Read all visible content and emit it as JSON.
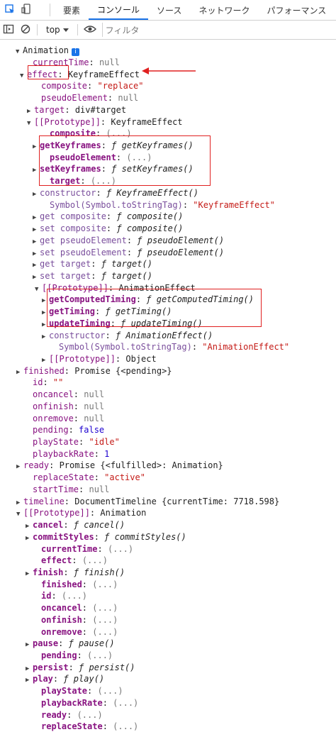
{
  "tabs": [
    "要素",
    "コンソール",
    "ソース",
    "ネットワーク",
    "パフォーマンス"
  ],
  "toolbar": {
    "context": "top",
    "filter_placeholder": "フィルタ"
  },
  "console": {
    "root_label": "Animation",
    "rows": [
      [
        "",
        "currentTime",
        ": ",
        "null"
      ],
      [
        "▼",
        "effect",
        ": ",
        "KeyframeEffect"
      ],
      [
        "",
        "composite",
        ": ",
        "\"replace\""
      ],
      [
        "",
        "pseudoElement",
        ": ",
        "null"
      ],
      [
        "▶",
        "target",
        ": ",
        "div#target"
      ],
      [
        "▼",
        "[[Prototype]]",
        ": ",
        "KeyframeEffect"
      ],
      [
        "",
        "composite",
        ": ",
        "(...)"
      ],
      [
        "▶",
        "getKeyframes",
        ": ",
        "ƒ getKeyframes()"
      ],
      [
        "",
        "pseudoElement",
        ": ",
        "(...)"
      ],
      [
        "▶",
        "setKeyframes",
        ": ",
        "ƒ setKeyframes()"
      ],
      [
        "",
        "target",
        ": ",
        "(...)"
      ],
      [
        "▶",
        "constructor",
        ": ",
        "ƒ KeyframeEffect()"
      ],
      [
        "",
        "Symbol(Symbol.toStringTag)",
        ": ",
        "\"KeyframeEffect\""
      ],
      [
        "▶",
        "get composite",
        ": ",
        "ƒ composite()"
      ],
      [
        "▶",
        "set composite",
        ": ",
        "ƒ composite()"
      ],
      [
        "▶",
        "get pseudoElement",
        ": ",
        "ƒ pseudoElement()"
      ],
      [
        "▶",
        "set pseudoElement",
        ": ",
        "ƒ pseudoElement()"
      ],
      [
        "▶",
        "get target",
        ": ",
        "ƒ target()"
      ],
      [
        "▶",
        "set target",
        ": ",
        "ƒ target()"
      ],
      [
        "▼",
        "[[Prototype]]",
        ": ",
        "AnimationEffect"
      ],
      [
        "▶",
        "getComputedTiming",
        ": ",
        "ƒ getComputedTiming()"
      ],
      [
        "▶",
        "getTiming",
        ": ",
        "ƒ getTiming()"
      ],
      [
        "▶",
        "updateTiming",
        ": ",
        "ƒ updateTiming()"
      ],
      [
        "▶",
        "constructor",
        ": ",
        "ƒ AnimationEffect()"
      ],
      [
        "",
        "Symbol(Symbol.toStringTag)",
        ": ",
        "\"AnimationEffect\""
      ],
      [
        "▶",
        "[[Prototype]]",
        ": ",
        "Object"
      ],
      [
        "▶",
        "finished",
        ": ",
        "Promise {<pending>}"
      ],
      [
        "",
        "id",
        ": ",
        "\"\""
      ],
      [
        "",
        "oncancel",
        ": ",
        "null"
      ],
      [
        "",
        "onfinish",
        ": ",
        "null"
      ],
      [
        "",
        "onremove",
        ": ",
        "null"
      ],
      [
        "",
        "pending",
        ": ",
        "false"
      ],
      [
        "",
        "playState",
        ": ",
        "\"idle\""
      ],
      [
        "",
        "playbackRate",
        ": ",
        "1"
      ],
      [
        "▶",
        "ready",
        ": ",
        "Promise {<fulfilled>: Animation}"
      ],
      [
        "",
        "replaceState",
        ": ",
        "\"active\""
      ],
      [
        "",
        "startTime",
        ": ",
        "null"
      ],
      [
        "▶",
        "timeline",
        ": ",
        "DocumentTimeline {currentTime: 7718.598}"
      ],
      [
        "▼",
        "[[Prototype]]",
        ": ",
        "Animation"
      ],
      [
        "▶",
        "cancel",
        ": ",
        "ƒ cancel()"
      ],
      [
        "▶",
        "commitStyles",
        ": ",
        "ƒ commitStyles()"
      ],
      [
        "",
        "currentTime",
        ": ",
        "(...)"
      ],
      [
        "",
        "effect",
        ": ",
        "(...)"
      ],
      [
        "▶",
        "finish",
        ": ",
        "ƒ finish()"
      ],
      [
        "",
        "finished",
        ": ",
        "(...)"
      ],
      [
        "",
        "id",
        ": ",
        "(...)"
      ],
      [
        "",
        "oncancel",
        ": ",
        "(...)"
      ],
      [
        "",
        "onfinish",
        ": ",
        "(...)"
      ],
      [
        "",
        "onremove",
        ": ",
        "(...)"
      ],
      [
        "▶",
        "pause",
        ": ",
        "ƒ pause()"
      ],
      [
        "",
        "pending",
        ": ",
        "(...)"
      ],
      [
        "▶",
        "persist",
        ": ",
        "ƒ persist()"
      ],
      [
        "▶",
        "play",
        ": ",
        "ƒ play()"
      ],
      [
        "",
        "playState",
        ": ",
        "(...)"
      ],
      [
        "",
        "playbackRate",
        ": ",
        "(...)"
      ],
      [
        "",
        "ready",
        ": ",
        "(...)"
      ],
      [
        "",
        "replaceState",
        ": ",
        "(...)"
      ]
    ]
  }
}
